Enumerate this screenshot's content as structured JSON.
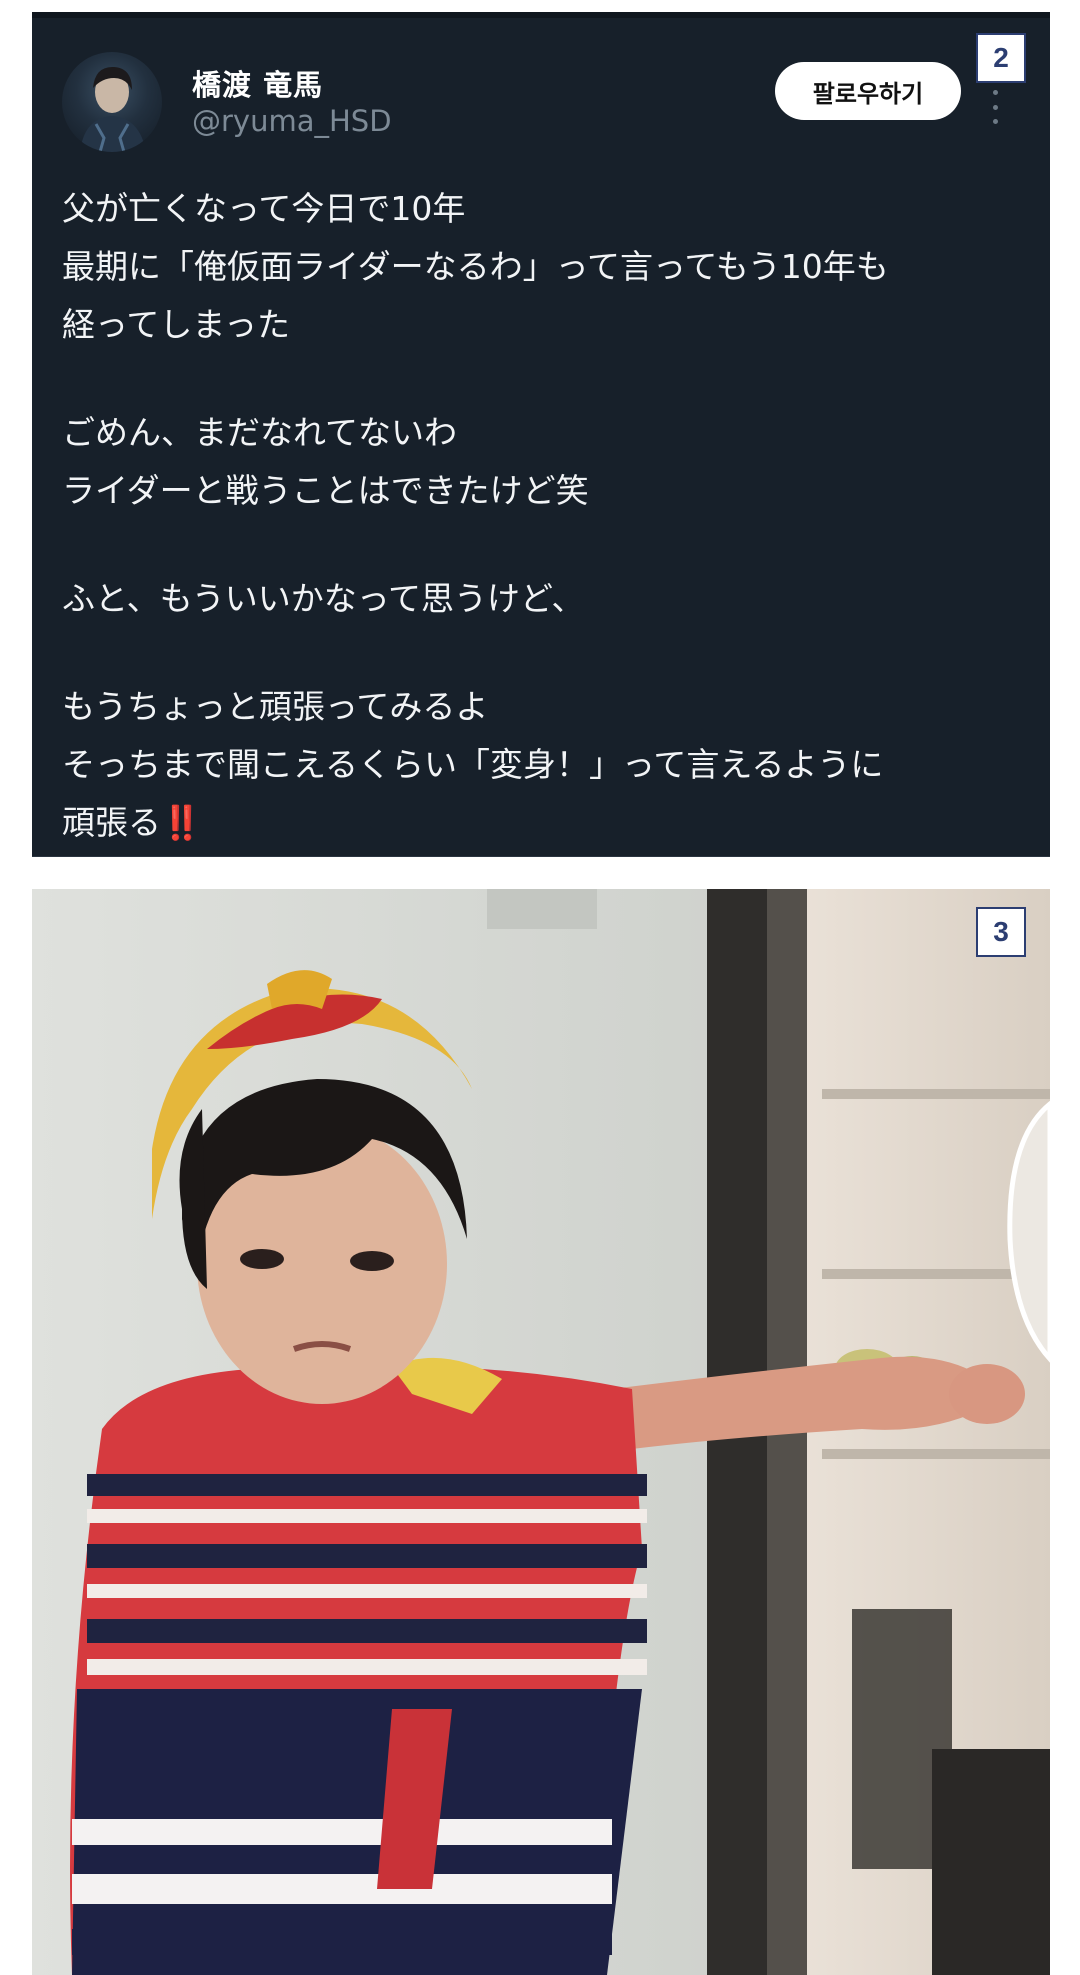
{
  "tweet": {
    "display_name": "橋渡 竜馬",
    "handle": "@ryuma_HSD",
    "follow_label": "팔로우하기",
    "avatar_icon": "user-avatar",
    "more_icon": "more-vertical-icon",
    "lines": [
      "父が亡くなって今日で10年",
      "最期に「俺仮面ライダーなるわ」って言ってもう10年も",
      "経ってしまった",
      "",
      "ごめん、まだなれてないわ",
      "ライダーと戦うことはできたけど笑",
      "",
      "ふと、もういいかなって思うけど、",
      "",
      "もうちょっと頑張ってみるよ",
      "そっちまで聞こえるくらい「変身！」って言えるように"
    ],
    "last_line_text": "頑張る",
    "last_line_emoji": "‼️"
  },
  "badges": {
    "first": "2",
    "second": "3"
  },
  "colors": {
    "tweet_background": "#17202a",
    "handle_gray": "#7d8a96",
    "badge_navy": "#2c3e72",
    "emoji_red": "#e0202a"
  }
}
